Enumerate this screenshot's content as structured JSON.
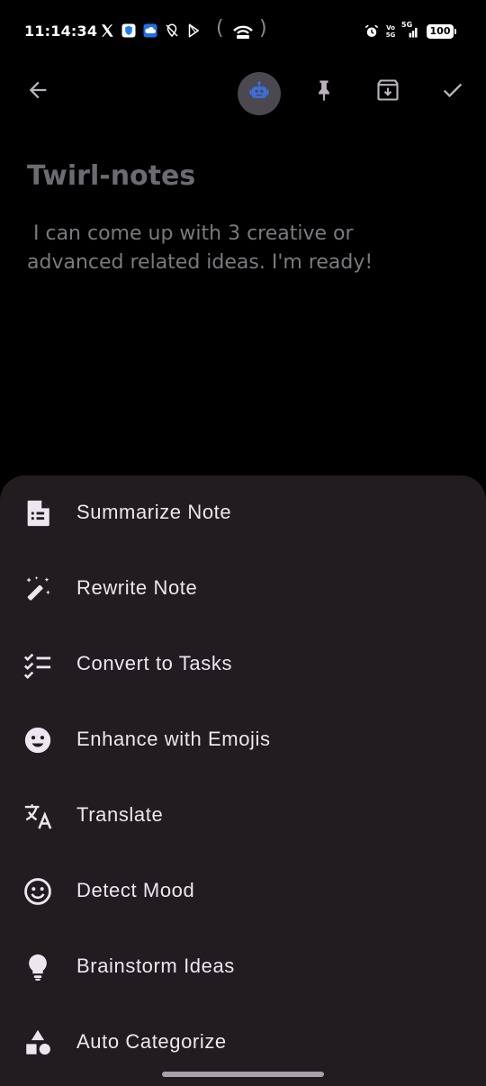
{
  "status_bar": {
    "time": "11:14:34",
    "battery": "100",
    "left_icons": [
      "x-icon",
      "shield-app-icon",
      "cloud-app-icon",
      "location-off-icon",
      "play-store-icon"
    ],
    "right_icons": [
      "alarm-icon",
      "volte-icon",
      "signal-5g-icon",
      "battery-icon"
    ],
    "network_label_top": "Vo",
    "network_label_bottom": "5G",
    "network_type": "5G"
  },
  "toolbar": {
    "back": "arrow-back-icon",
    "ai": "robot-icon",
    "pin": "pin-icon",
    "archive": "archive-icon",
    "done": "check-icon"
  },
  "note": {
    "title": "Twirl-notes",
    "body": " I can come up with 3 creative or\nadvanced related ideas. I'm ready!"
  },
  "menu": {
    "items": [
      {
        "label": "Summarize Note",
        "icon": "summarize-icon"
      },
      {
        "label": "Rewrite Note",
        "icon": "magic-wand-icon"
      },
      {
        "label": "Convert to Tasks",
        "icon": "checklist-icon"
      },
      {
        "label": "Enhance with Emojis",
        "icon": "emoji-filled-icon"
      },
      {
        "label": "Translate",
        "icon": "translate-icon"
      },
      {
        "label": "Detect Mood",
        "icon": "mood-outline-icon"
      },
      {
        "label": "Brainstorm Ideas",
        "icon": "lightbulb-icon"
      },
      {
        "label": "Auto Categorize",
        "icon": "category-icon"
      }
    ]
  },
  "colors": {
    "background": "#000000",
    "sheet": "#221c20",
    "ai_button": "#4b4850",
    "ai_icon": "#3b6fd8",
    "menu_text": "#ece6ee"
  }
}
